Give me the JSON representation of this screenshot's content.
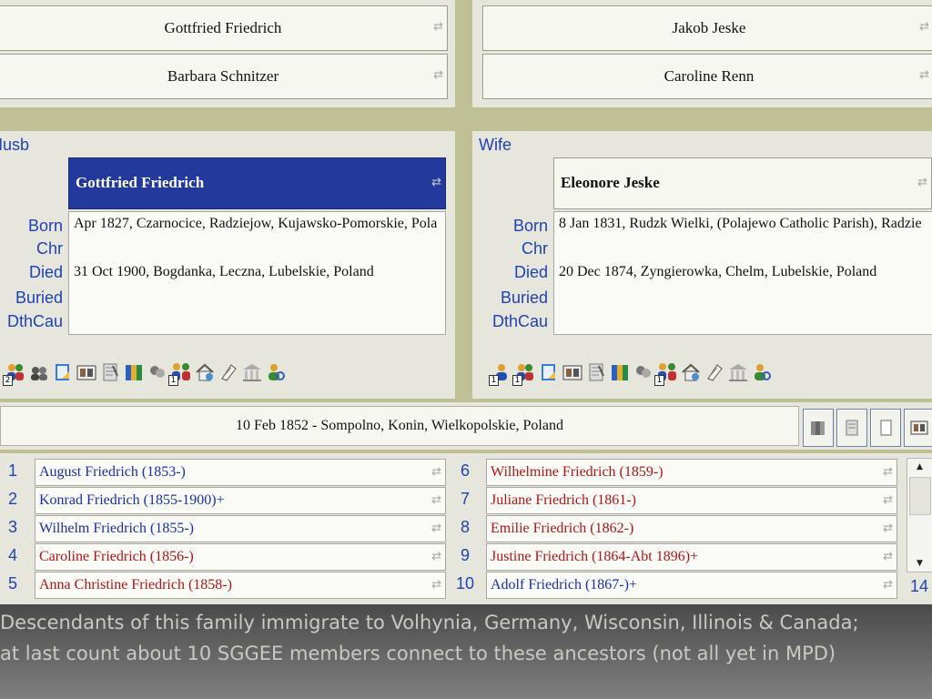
{
  "parents": {
    "husband_father": "Gottfried Friedrich",
    "husband_mother": "Barbara Schnitzer",
    "wife_father": "Jakob Jeske",
    "wife_mother": "Caroline Renn"
  },
  "swap_glyph": "⇄",
  "husband": {
    "section_label": "Husb",
    "name": "Gottfried Friedrich",
    "born": "Apr 1827, Czarnocice, Radziejow, Kujawsko-Pomorskie, Pola",
    "chr": "",
    "died": "31 Oct 1900, Bogdanka, Leczna, Lubelskie, Poland",
    "buried": "",
    "dthcau": ""
  },
  "wife": {
    "section_label": "Wife",
    "name": "Eleonore Jeske",
    "born": "8 Jan 1831, Rudzk Wielki, (Polajewo Catholic Parish), Radzie",
    "chr": "",
    "died": "20 Dec 1874, Zyngierowka, Chelm, Lubelskie, Poland",
    "buried": "",
    "dthcau": ""
  },
  "fact_labels": {
    "born": "Born",
    "chr": "Chr",
    "died": "Died",
    "buried": "Buried",
    "dthcau": "DthCau"
  },
  "husband_icons": {
    "spouses_badge": "2",
    "parents_badge": "1"
  },
  "wife_icons": {
    "person_badge": "1",
    "spouses_badge": "1",
    "parents_badge": "1"
  },
  "marriage": {
    "text": "10 Feb 1852 - Sompolno, Konin, Wielkopolskie, Poland"
  },
  "children": [
    {
      "num": "1",
      "name": "August Friedrich (1853-)",
      "sex": "male"
    },
    {
      "num": "2",
      "name": "Konrad Friedrich (1855-1900)+",
      "sex": "male"
    },
    {
      "num": "3",
      "name": "Wilhelm Friedrich (1855-)",
      "sex": "male"
    },
    {
      "num": "4",
      "name": "Caroline Friedrich (1856-)",
      "sex": "female"
    },
    {
      "num": "5",
      "name": "Anna Christine Friedrich (1858-)",
      "sex": "female"
    },
    {
      "num": "6",
      "name": "Wilhelmine Friedrich (1859-)",
      "sex": "female"
    },
    {
      "num": "7",
      "name": "Juliane Friedrich (1861-)",
      "sex": "female"
    },
    {
      "num": "8",
      "name": "Emilie Friedrich (1862-)",
      "sex": "female"
    },
    {
      "num": "9",
      "name": "Justine Friedrich (1864-Abt 1896)+",
      "sex": "female"
    },
    {
      "num": "10",
      "name": "Adolf Friedrich (1867-)+",
      "sex": "male"
    }
  ],
  "children_count": "14",
  "colors": {
    "male": "#1a2fa8",
    "female": "#b01414",
    "selected_bg": "#23399b",
    "label_blue": "#1d43b4"
  },
  "caption": {
    "line1": "Descendants of this family immigrate to Volhynia, Germany, Wisconsin, Illinois & Canada;",
    "line2": "at last count about 10 SGGEE members connect to these ancestors (not all yet in MPD)"
  }
}
